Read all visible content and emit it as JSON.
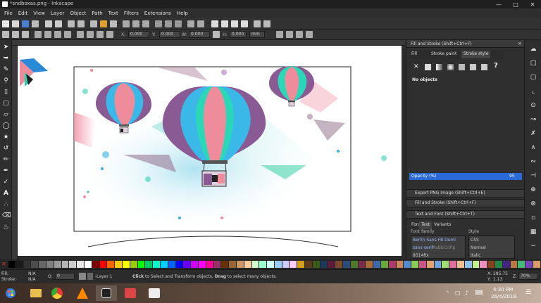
{
  "window": {
    "title": "*sndboxas.png - Inkscape"
  },
  "menu": [
    "File",
    "Edit",
    "View",
    "Layer",
    "Object",
    "Path",
    "Text",
    "Filters",
    "Extensions",
    "Help"
  ],
  "controls": {
    "x_label": "X:",
    "y_label": "Y:",
    "w_label": "W:",
    "h_label": "H:",
    "x_value": "0.000",
    "y_value": "0.000",
    "w_value": "0.000",
    "h_value": "0.000",
    "unit": "mm"
  },
  "dock": {
    "header_title": "Fill and Stroke (Shift+Ctrl+F)",
    "tabs": [
      "Fill",
      "Stroke paint",
      "Stroke style"
    ],
    "no_objects": "No objects",
    "opacity_label": "Opacity (%)",
    "opacity_value": "95",
    "sections": [
      "Export PNG Image (Shift+Ctrl+E)",
      "Fill and Stroke (Shift+Ctrl+F)",
      "Text and Font (Shift+Ctrl+T)"
    ],
    "font_tabs": [
      "Font",
      "Text",
      "Variants"
    ],
    "font_family_label": "Font family",
    "style_label": "Style",
    "font_list": [
      "Berlin Sans FB Demi",
      "sans-serif",
      "8514fix"
    ],
    "font_preview": "AaBbCcIPp",
    "style_list": [
      "CSS",
      "Normal",
      "Italic"
    ]
  },
  "status": {
    "fill_label": "Fill:",
    "stroke_label": "Stroke:",
    "fill_value": "N/A",
    "stroke_value": "N/A",
    "opacity_label": "O:",
    "opacity_value": "0",
    "layer": "-Layer 1",
    "message_bold1": "Click",
    "message_1": " to Select and Transform objects, ",
    "message_bold2": "Drag",
    "message_2": " to select many objects.",
    "x_label": "X:",
    "y_label": "Y:",
    "x_value": "285.75",
    "y_value": "1.13",
    "z_label": "Z:",
    "zoom": "70%"
  },
  "taskbar": {
    "time": "4:30 PM",
    "date": "26/4/2018"
  },
  "palette": [
    "#000000",
    "#1a1a1a",
    "#333333",
    "#4d4d4d",
    "#666666",
    "#808080",
    "#999999",
    "#b3b3b3",
    "#cccccc",
    "#e6e6e6",
    "#ffffff",
    "#800000",
    "#ff0000",
    "#ff6600",
    "#ffcc00",
    "#ffff00",
    "#99cc00",
    "#00ff00",
    "#00cc66",
    "#00ffcc",
    "#00ccff",
    "#0066ff",
    "#0000ff",
    "#6600ff",
    "#cc00ff",
    "#ff00ff",
    "#ff0099",
    "#993366",
    "#663300",
    "#996633",
    "#cc9966",
    "#ffcc99",
    "#ccffcc",
    "#99ffcc",
    "#ccffff",
    "#99ccff",
    "#ccccff",
    "#ffccff",
    "#d4a017",
    "#5a3a1a",
    "#3a5a1a",
    "#1a3a5a",
    "#5a1a3a",
    "#7a4a2a",
    "#2a4a7a",
    "#4a7a2a",
    "#7a2a4a",
    "#aa6a3a",
    "#3a6aaa",
    "#6aaa3a",
    "#aa3a6a",
    "#cc8855",
    "#5588cc",
    "#88cc55",
    "#cc5588",
    "#e0a070",
    "#70a0e0",
    "#a0e070",
    "#e070a0",
    "#f0c090",
    "#90c0f0",
    "#c0f090",
    "#f090c0",
    "#884422",
    "#228844",
    "#442288",
    "#bb7744",
    "#44bb77",
    "#7744bb",
    "#dd9966"
  ]
}
